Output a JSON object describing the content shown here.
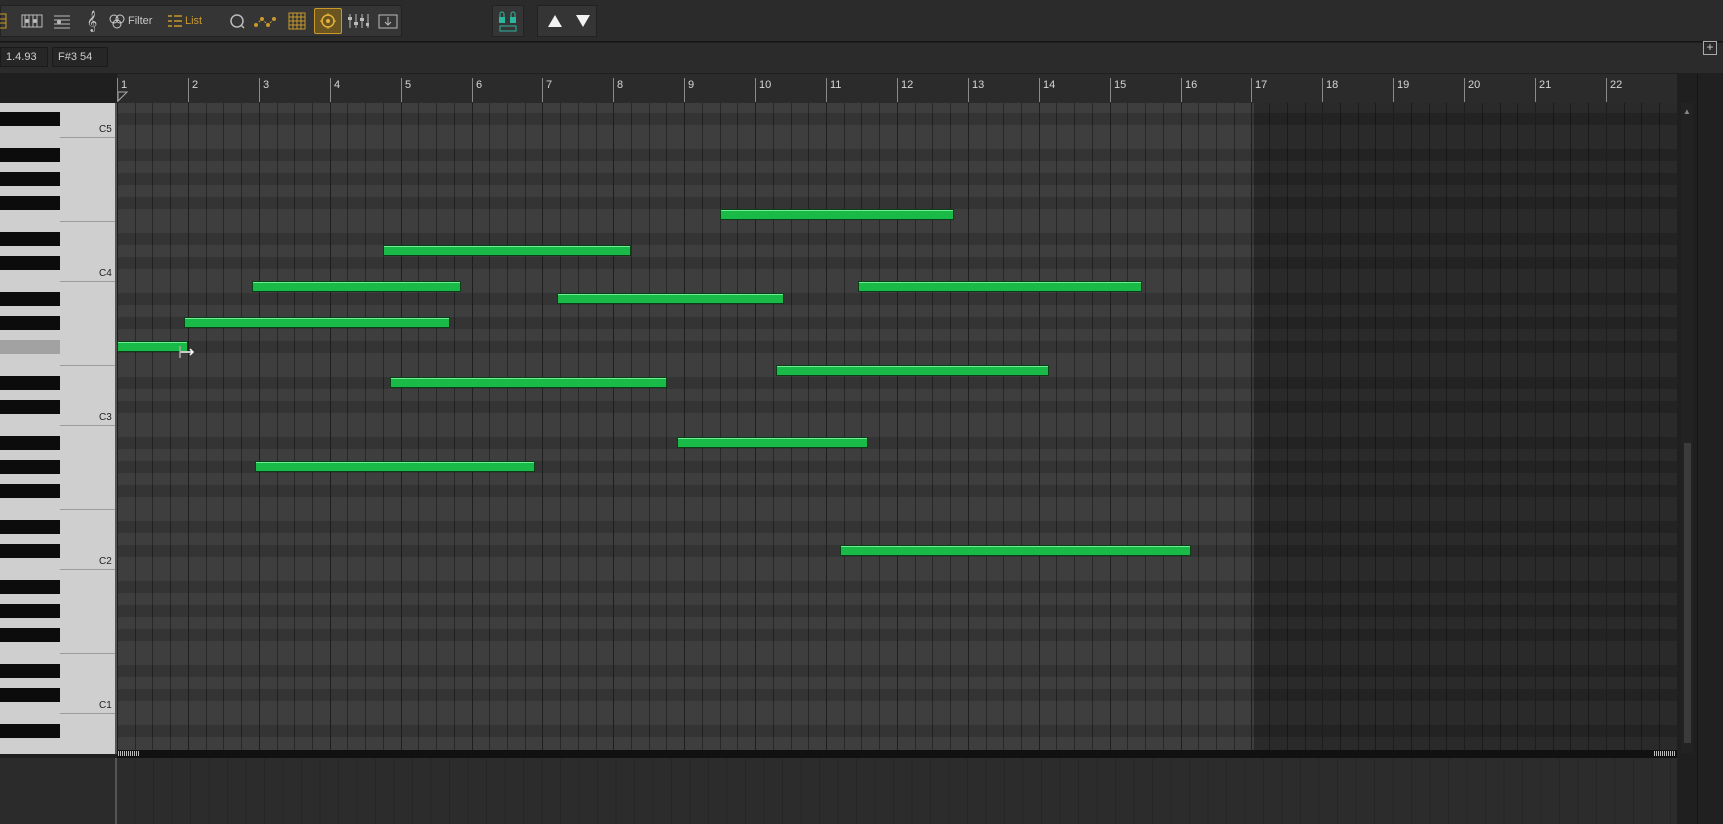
{
  "toolbar": {
    "filter_label": "Filter",
    "list_label": "List",
    "colors": {
      "accent": "#c99a2a",
      "text": "#c8c8c8"
    }
  },
  "infobar": {
    "position": "1.4.93",
    "note_value": "F#3  54"
  },
  "ruler": {
    "bars": [
      "1",
      "2",
      "3",
      "4",
      "5",
      "6",
      "7",
      "8",
      "9",
      "10",
      "11",
      "12",
      "13",
      "14",
      "15",
      "16",
      "17",
      "18",
      "19",
      "20",
      "21",
      "22"
    ]
  },
  "keyboard": {
    "labels": {
      "c5": "C5",
      "c4": "C4",
      "c3": "C3",
      "c2": "C2",
      "c1": "C1"
    },
    "highlighted_key": "F#3"
  },
  "notes": {
    "color": "#1aba48",
    "items": [
      {
        "pitch": "F#3",
        "start_bar": 1.0,
        "length_bars": 1.0
      },
      {
        "pitch": "G#3",
        "start_bar": 1.95,
        "length_bars": 3.75
      },
      {
        "pitch": "B3",
        "start_bar": 2.9,
        "length_bars": 2.95
      },
      {
        "pitch": "D4",
        "start_bar": 4.75,
        "length_bars": 3.5
      },
      {
        "pitch": "D#3",
        "start_bar": 4.85,
        "length_bars": 3.9
      },
      {
        "pitch": "G#2",
        "start_bar": 2.95,
        "length_bars": 3.95
      },
      {
        "pitch": "A#3",
        "start_bar": 7.2,
        "length_bars": 3.2
      },
      {
        "pitch": "F4",
        "start_bar": 9.5,
        "length_bars": 3.3
      },
      {
        "pitch": "A#2",
        "start_bar": 8.9,
        "length_bars": 2.7
      },
      {
        "pitch": "E3",
        "start_bar": 10.3,
        "length_bars": 3.85
      },
      {
        "pitch": "B3",
        "start_bar": 11.45,
        "length_bars": 4.0
      },
      {
        "pitch": "C#2",
        "start_bar": 11.2,
        "length_bars": 4.95
      }
    ]
  }
}
